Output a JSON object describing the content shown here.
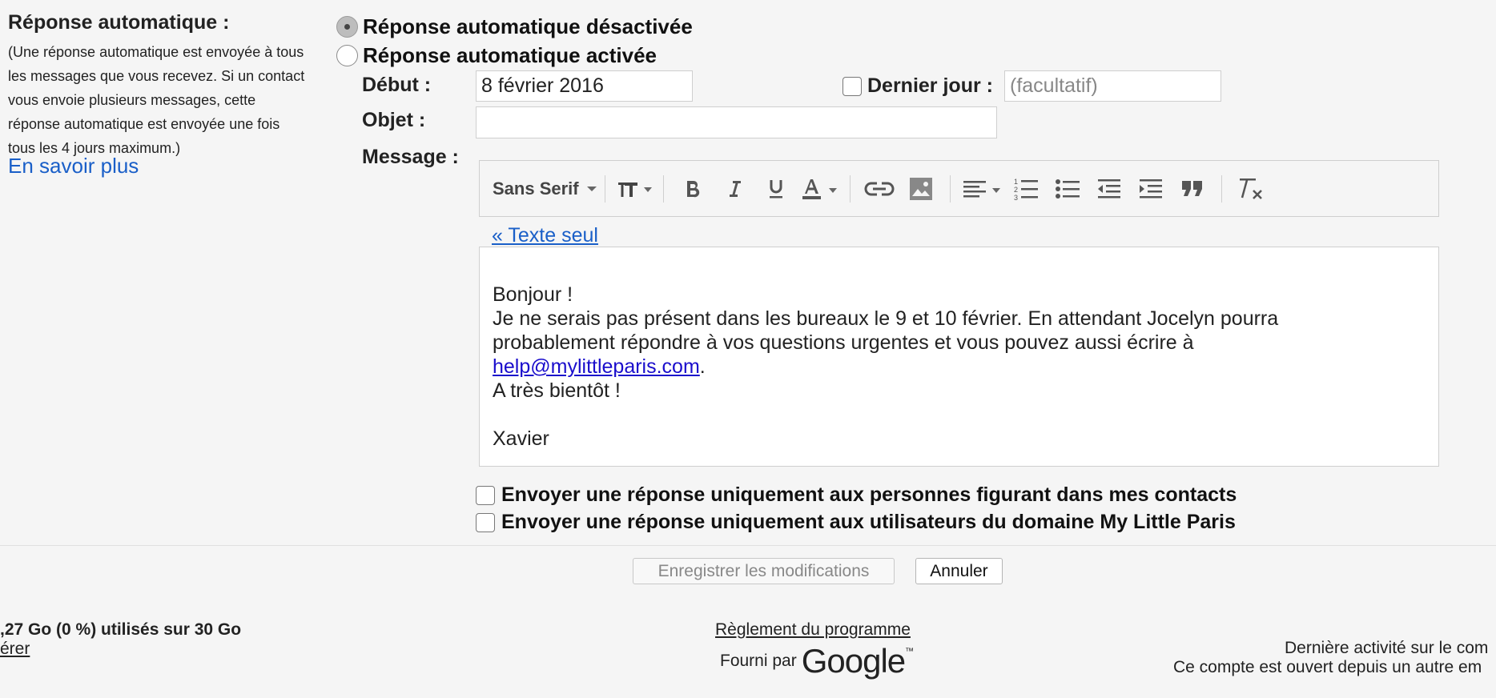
{
  "left": {
    "title": "Réponse automatique :",
    "description": "(Une réponse automatique est envoyée à tous les messages que vous recevez. Si un contact vous envoie plusieurs messages, cette réponse automatique est envoyée une fois tous les 4 jours maximum.)",
    "learn_more": "En savoir plus"
  },
  "radios": {
    "off_label": "Réponse automatique désactivée",
    "on_label": "Réponse automatique activée",
    "selected": "off"
  },
  "fields": {
    "start_label": "Début :",
    "start_value": "8 février 2016",
    "last_day_label": "Dernier jour :",
    "last_day_placeholder": "(facultatif)",
    "subject_label": "Objet :",
    "subject_value": "",
    "message_label": "Message :"
  },
  "toolbar": {
    "font_name": "Sans Serif",
    "icons": [
      "text-size-icon",
      "bold-icon",
      "italic-icon",
      "underline-icon",
      "text-color-icon",
      "link-icon",
      "image-icon",
      "align-icon",
      "numbered-list-icon",
      "bulleted-list-icon",
      "indent-less-icon",
      "indent-more-icon",
      "quote-icon",
      "remove-formatting-icon"
    ]
  },
  "editor": {
    "plain_text_link": "« Texte seul",
    "greeting": "Bonjour !",
    "line1": "Je ne serais pas présent dans les bureaux le 9 et 10 février. En attendant Jocelyn pourra",
    "line2": "probablement répondre à vos questions urgentes et vous pouvez aussi écrire à",
    "email": "help@mylittleparis.com",
    "email_suffix": ".",
    "closing": "A très bientôt !",
    "signature": "Xavier"
  },
  "options": {
    "contacts_only": "Envoyer une réponse uniquement aux personnes figurant dans mes contacts",
    "domain_only": "Envoyer une réponse uniquement aux utilisateurs du domaine My Little Paris"
  },
  "buttons": {
    "save": "Enregistrer les modifications",
    "cancel": "Annuler"
  },
  "footer": {
    "storage": ",27 Go (0 %) utilisés sur 30 Go",
    "manage": "érer",
    "program_policy": "Règlement du programme",
    "powered_by": "Fourni par",
    "google": "Google",
    "tm": "™",
    "last_activity": "Dernière activité sur le com",
    "open_elsewhere": "Ce compte est ouvert depuis un autre em"
  },
  "colors": {
    "link": "#1a5fc8",
    "background": "#f5f5f5"
  }
}
